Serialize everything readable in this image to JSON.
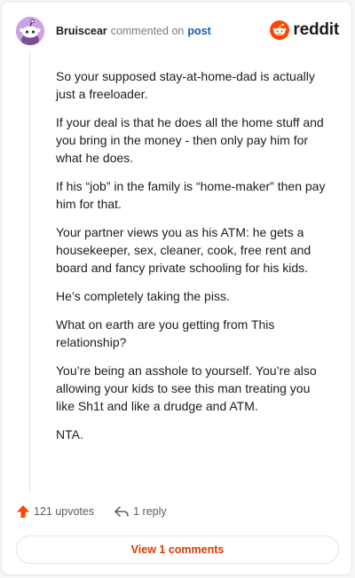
{
  "header": {
    "username": "Bruiscear",
    "action_text": "commented on",
    "post_link": "post",
    "brand_name": "reddit"
  },
  "comment": {
    "paragraphs": [
      "So your supposed stay-at-home-dad is actually just a freeloader.",
      "If your deal is that he does all the home stuff and you bring in the money - then only pay him for what he does.",
      "If his “job” in the family is “home-maker” then pay him for that.",
      "Your partner views you as his ATM: he gets a housekeeper, sex, cleaner, cook, free rent and board and fancy private schooling for his kids.",
      "He’s completely taking the piss.",
      "What on earth are you getting from This relationship?",
      "You’re being an asshole to yourself. You’re also allowing your kids to see this man treating you like Sh1t and like a drudge and ATM.",
      "NTA."
    ]
  },
  "actions": {
    "upvotes_label": "121 upvotes",
    "reply_label": "1 reply"
  },
  "footer": {
    "view_comments_label": "View 1 comments"
  },
  "colors": {
    "brand": "#ff4500",
    "upvote": "#ff4500",
    "link": "#0f5fb0",
    "view_button_text": "#d93a00",
    "avatar_bg": "#c9a3e6"
  },
  "icons": {
    "avatar": "snoo-avatar-icon",
    "brand": "reddit-logo-icon",
    "upvote": "upvote-arrow-icon",
    "reply": "reply-arrow-icon"
  }
}
